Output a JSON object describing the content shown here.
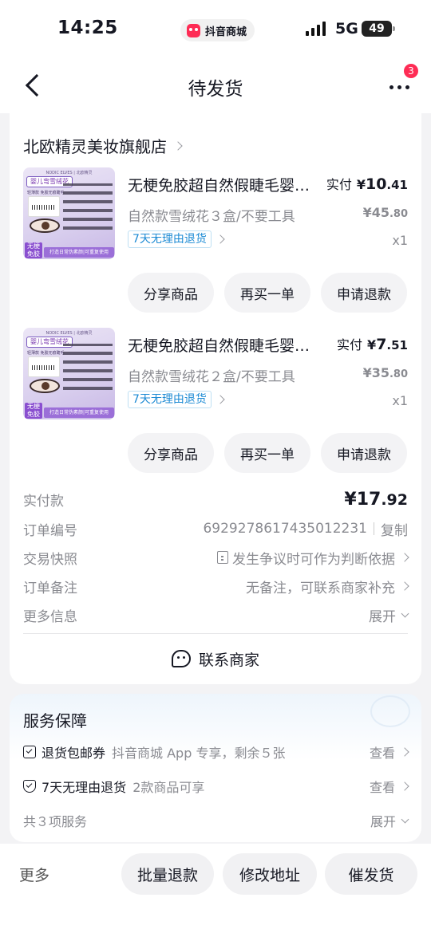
{
  "status_bar": {
    "time": "14:25",
    "app_name": "抖音商城",
    "network": "5G",
    "battery": "49"
  },
  "nav": {
    "title": "待发货",
    "badge_count": "3"
  },
  "shop": {
    "name": "北欧精灵美妆旗舰店"
  },
  "items": [
    {
      "title": "无梗免胶超自然假睫毛婴儿弯雪绒花",
      "paid_label": "实付",
      "price_symbol": "¥",
      "price_int": "10",
      "price_dec": ".41",
      "variant": "自然款雪绒花３盒/不要工具",
      "orig_price_int": "¥45",
      "orig_price_dec": ".80",
      "return_tag": "7天无理由退货",
      "qty": "x1",
      "thumb": {
        "brand": "NODIC ELVES | 北欧精灵",
        "tag": "婴儿弯雪绒花",
        "sub": "轻薄款 免胶无痕睫毛",
        "badge": "无梗免胶",
        "strip": "打造日常伪素颜|可重复使用"
      }
    },
    {
      "title": "无梗免胶超自然假睫毛婴儿弯雪绒花",
      "paid_label": "实付",
      "price_symbol": "¥",
      "price_int": "7",
      "price_dec": ".51",
      "variant": "自然款雪绒花２盒/不要工具",
      "orig_price_int": "¥35",
      "orig_price_dec": ".80",
      "return_tag": "7天无理由退货",
      "qty": "x1",
      "thumb": {
        "brand": "NODIC ELVES | 北欧精灵",
        "tag": "婴儿弯雪绒花",
        "sub": "轻薄款 免胶无痕睫毛",
        "badge": "无梗免胶",
        "strip": "打造日常伪素颜|可重复使用"
      }
    }
  ],
  "item_buttons": {
    "share": "分享商品",
    "rebuy": "再买一单",
    "refund": "申请退款"
  },
  "order_info": {
    "total_label": "实付款",
    "total_int": "¥17",
    "total_dec": ".92",
    "order_no_label": "订单编号",
    "order_no": "6929278617435012231",
    "copy": "复制",
    "snapshot_label": "交易快照",
    "snapshot_value": "发生争议时可作为判断依据",
    "remark_label": "订单备注",
    "remark_value": "无备注，可联系商家补充",
    "more_label": "更多信息",
    "expand": "展开"
  },
  "contact_label": "联系商家",
  "service": {
    "title": "服务保障",
    "rows": [
      {
        "name": "退货包邮券",
        "desc": "抖音商城 App 专享，剩余５张",
        "action": "查看"
      },
      {
        "name": "7天无理由退货",
        "desc": "2款商品可享",
        "action": "查看"
      }
    ],
    "count": "共３项服务",
    "expand": "展开"
  },
  "bottom": {
    "more": "更多",
    "batch_refund": "批量退款",
    "modify_address": "修改地址",
    "urge_ship": "催发货"
  },
  "colors": {
    "accent_red": "#fe2c55",
    "tag_blue": "#1b8ad4",
    "text_primary": "#161823",
    "text_secondary": "#8a8b91"
  }
}
